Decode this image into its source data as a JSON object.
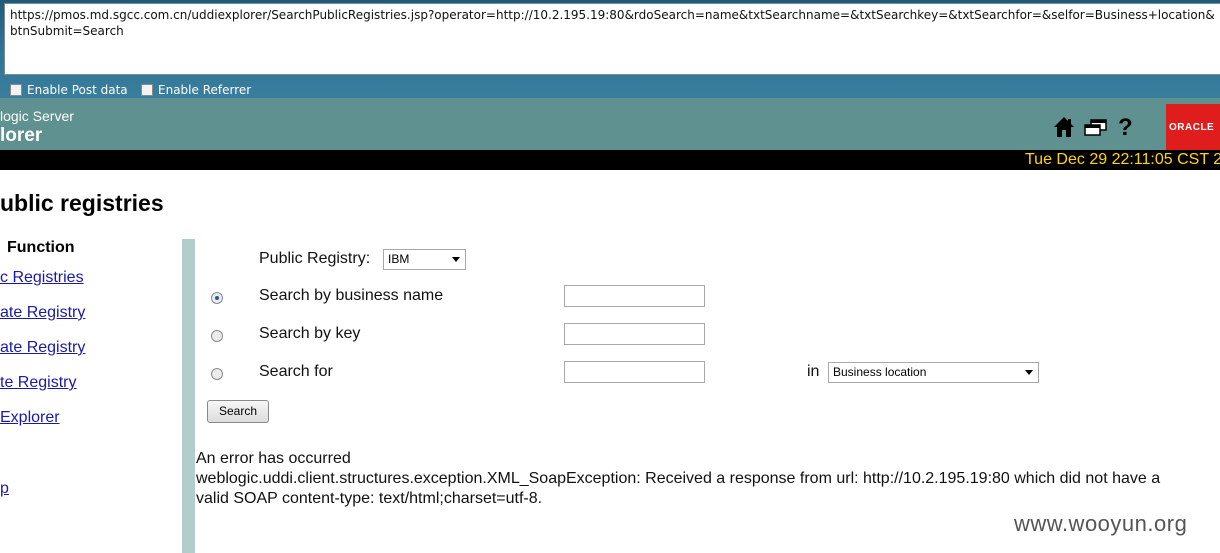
{
  "browser": {
    "url": "https://pmos.md.sgcc.com.cn/uddiexplorer/SearchPublicRegistries.jsp?operator=http://10.2.195.19:80&rdoSearch=name&txtSearchname=&txtSearchkey=&txtSearchfor=&selfor=Business+location&btnSubmit=Search",
    "enable_post_label": "Enable Post data",
    "enable_referrer_label": "Enable Referrer"
  },
  "header": {
    "product_line": "logic Server",
    "app_name": "lorer",
    "logo_text": "ORACLE",
    "date": "Tue Dec 29 22:11:05 CST 2",
    "icons": [
      "home-icon",
      "windows-icon",
      "help-icon"
    ]
  },
  "page": {
    "title": "ublic registries"
  },
  "sidebar": {
    "heading": "Function",
    "items": [
      {
        "label": "c Registries"
      },
      {
        "label": "ate Registry"
      },
      {
        "label": "ate Registry"
      },
      {
        "label": "te Registry"
      },
      {
        "label": "Explorer"
      },
      {
        "label": "p"
      }
    ]
  },
  "form": {
    "public_registry_label": "Public Registry:",
    "public_registry_value": "IBM",
    "search_by_name_label": "Search by business name",
    "search_by_key_label": "Search by key",
    "search_for_label": "Search for",
    "in_label": "in",
    "in_value": "Business location",
    "search_button": "Search",
    "selected_option": "name"
  },
  "error": {
    "title": "An error has occurred",
    "line1": "weblogic.uddi.client.structures.exception.XML_SoapException: Received a response from url: http://10.2.195.19:80 which did not have a",
    "line2": "valid SOAP content-type: text/html;charset=utf-8."
  },
  "watermark": "www.wooyun.org",
  "colors": {
    "header_bg": "#5e9190",
    "date_text": "#ffd700",
    "link": "#1a1aa6",
    "oracle_red": "#e01d1d",
    "sidebar_bar": "#b3cccc"
  }
}
